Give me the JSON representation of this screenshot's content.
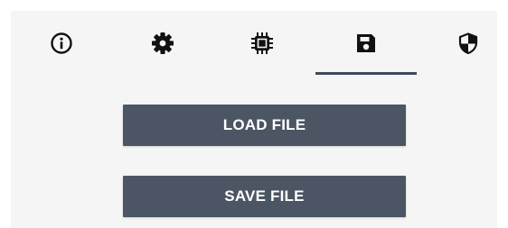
{
  "tabs": [
    {
      "icon": "info-icon",
      "selected": false
    },
    {
      "icon": "gear-icon",
      "selected": false
    },
    {
      "icon": "chip-icon",
      "selected": false
    },
    {
      "icon": "save-icon",
      "selected": true
    },
    {
      "icon": "shield-icon",
      "selected": false
    }
  ],
  "actions": {
    "load_label": "LOAD FILE",
    "save_label": "SAVE FILE"
  },
  "colors": {
    "background": "#f5f5f5",
    "button": "#4b5563",
    "button_text": "#ffffff",
    "icon": "#111111",
    "indicator": "#3e4a59"
  }
}
